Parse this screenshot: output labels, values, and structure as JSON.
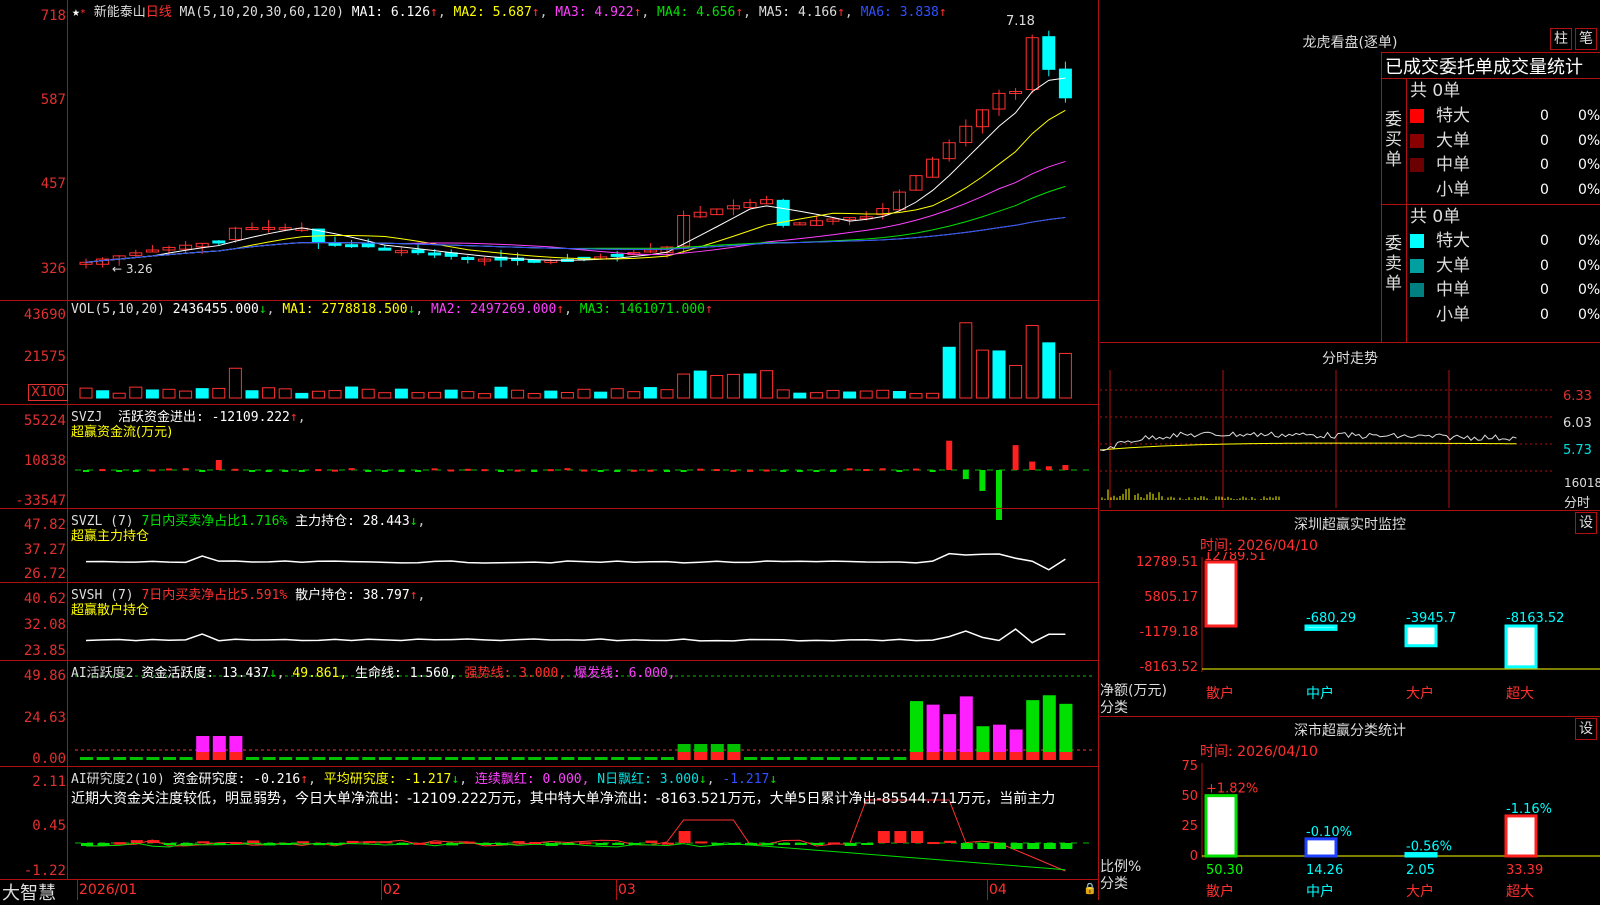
{
  "title_bar": {
    "stock_name": "新能泰山",
    "period": "日线",
    "ma_params": "MA(5,10,20,30,60,120)",
    "ma1": "MA1: 6.126",
    "ma2": "MA2: 5.687",
    "ma3": "MA3: 4.922",
    "ma4": "MA4: 4.656",
    "ma5": "MA5: 4.166",
    "ma6": "MA6: 3.838",
    "high_label": "7.18",
    "low_label": "3.26"
  },
  "price_axis": [
    "718",
    "587",
    "457",
    "326"
  ],
  "vol_panel": {
    "header": "VOL(5,10,20)",
    "value": "2436455.000",
    "ma1": "MA1: 2778818.500",
    "ma2": "MA2: 2497269.000",
    "ma3": "MA3: 1461071.000",
    "axis": [
      "43690",
      "21575"
    ],
    "unit": "X100"
  },
  "svzj_panel": {
    "header": "SVZJ",
    "text": "活跃资金进出: -12109.222",
    "subtitle": "超赢资金流(万元)",
    "axis": [
      "55224",
      "10838",
      "-33547"
    ]
  },
  "svzl_panel": {
    "header": "SVZL (7)",
    "text1": "7日内买卖净占比1.716%",
    "text2": "主力持仓: 28.443",
    "subtitle": "超赢主力持仓",
    "axis": [
      "47.82",
      "37.27",
      "26.72"
    ]
  },
  "svsh_panel": {
    "header": "SVSH (7)",
    "text1": "7日内买卖净占比5.591%",
    "text2": "散户持仓: 38.797",
    "subtitle": "超赢散户持仓",
    "axis": [
      "40.62",
      "32.08",
      "23.85"
    ]
  },
  "ai_active_panel": {
    "header": "AI活跃度2",
    "t1": "资金活跃度: 13.437",
    "t2": "49.861,",
    "t3": "生命线: 1.560,",
    "t4": "强势线: 3.000,",
    "t5": "爆发线: 6.000,",
    "axis": [
      "49.86",
      "24.63",
      "0.00"
    ]
  },
  "ai_research_panel": {
    "header": "AI研究度2(10)",
    "t1": "资金研究度: -0.216",
    "t2": "平均研究度: -1.217",
    "t3": "连续飘红: 0.000,",
    "t4": "N日飘红: 3.000",
    "t5": "-1.217",
    "comment": "近期大资金关注度较低，明显弱势，今日大单净流出：-12109.222万元，其中特大单净流出：-8163.521万元，大单5日累计净出-85544.711万元，当前主力",
    "axis": [
      "2.11",
      "0.45",
      "-1.22"
    ]
  },
  "bottom_bar": {
    "logo": "大智慧",
    "months": [
      "2026/01",
      "02",
      "03",
      "04"
    ]
  },
  "dragon_tiger": {
    "title": "龙虎看盘(逐单)",
    "btn_bar": "柱",
    "btn_pen": "笔",
    "subtitle": "已成交委托单成交量统计",
    "buy_label": "委买单",
    "sell_label": "委卖单",
    "buy_total": "共 0单",
    "sell_total": "共 0单",
    "buy_rows": [
      {
        "name": "特大",
        "count": "0",
        "pct": "0%",
        "color": "#ff0000"
      },
      {
        "name": "大单",
        "count": "0",
        "pct": "0%",
        "color": "#8a0000"
      },
      {
        "name": "中单",
        "count": "0",
        "pct": "0%",
        "color": "#6a0000"
      },
      {
        "name": "小单",
        "count": "0",
        "pct": "0%",
        "color": ""
      }
    ],
    "sell_rows": [
      {
        "name": "特大",
        "count": "0",
        "pct": "0%",
        "color": "#00ffff"
      },
      {
        "name": "大单",
        "count": "0",
        "pct": "0%",
        "color": "#00a0a0"
      },
      {
        "name": "中单",
        "count": "0",
        "pct": "0%",
        "color": "#008080"
      },
      {
        "name": "小单",
        "count": "0",
        "pct": "0%",
        "color": ""
      }
    ]
  },
  "intraday": {
    "title": "分时走势",
    "axis": [
      "6.33",
      "6.03",
      "5.73"
    ],
    "vol_label": "16018",
    "time_label": "分时"
  },
  "realtime_monitor": {
    "title": "深圳超赢实时监控",
    "btn": "设",
    "time": "时间: 2026/04/10",
    "axis": [
      "12789.51",
      "5805.17",
      "-1179.18",
      "-8163.52"
    ],
    "y_title1": "净额(万元)",
    "y_title2": "分类",
    "bars": [
      {
        "name": "散户",
        "value": "12789.51",
        "num": 12789.51
      },
      {
        "name": "中户",
        "value": "-680.29",
        "num": -680.29
      },
      {
        "name": "大户",
        "value": "-3945.7",
        "num": -3945.7
      },
      {
        "name": "超大",
        "value": "-8163.52",
        "num": -8163.52
      }
    ]
  },
  "category_stats": {
    "title": "深市超赢分类统计",
    "btn": "设",
    "time": "时间: 2026/04/10",
    "axis": [
      "75",
      "50",
      "25",
      "0"
    ],
    "y_title1": "比例%",
    "y_title2": "分类",
    "bars": [
      {
        "name": "散户",
        "pct": "50.30",
        "change": "+1.82%",
        "num": 50.3
      },
      {
        "name": "中户",
        "pct": "14.26",
        "change": "-0.10%",
        "num": 14.26
      },
      {
        "name": "大户",
        "pct": "2.05",
        "change": "-0.56%",
        "num": 2.05
      },
      {
        "name": "超大",
        "pct": "33.39",
        "change": "-1.16%",
        "num": 33.39
      }
    ]
  }
}
